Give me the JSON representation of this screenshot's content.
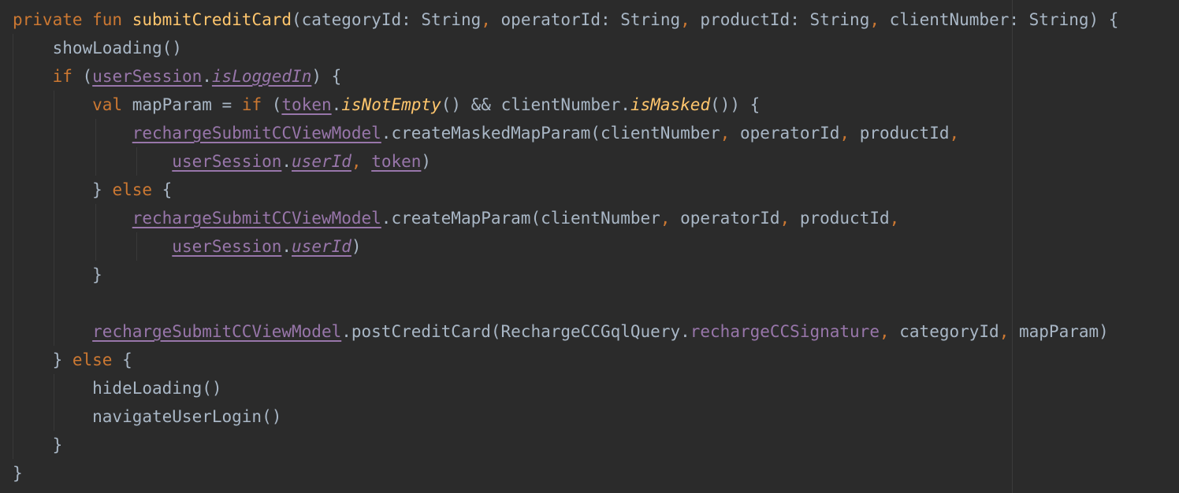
{
  "editor": {
    "language": "kotlin",
    "theme_colors": {
      "background": "#2b2b2b",
      "plain": "#a9b7c6",
      "keyword": "#cc7832",
      "function": "#ffc66d",
      "property": "#9876aa"
    },
    "lines": [
      [
        {
          "t": "private fun ",
          "k": "keyword"
        },
        {
          "t": "submitCreditCard",
          "k": "function"
        },
        {
          "t": "(categoryId: String",
          "k": "plain"
        },
        {
          "t": ", ",
          "k": "comma"
        },
        {
          "t": "operatorId: String",
          "k": "plain"
        },
        {
          "t": ", ",
          "k": "comma"
        },
        {
          "t": "productId: String",
          "k": "plain"
        },
        {
          "t": ", ",
          "k": "comma"
        },
        {
          "t": "clientNumber: String) {",
          "k": "plain"
        }
      ],
      [
        {
          "t": "    showLoading()",
          "k": "plain"
        }
      ],
      [
        {
          "t": "    ",
          "k": "plain"
        },
        {
          "t": "if ",
          "k": "keyword"
        },
        {
          "t": "(",
          "k": "plain"
        },
        {
          "t": "userSession",
          "k": "prop"
        },
        {
          "t": ".",
          "k": "plain"
        },
        {
          "t": "isLoggedIn",
          "k": "prop-italic"
        },
        {
          "t": ") {",
          "k": "plain"
        }
      ],
      [
        {
          "t": "        ",
          "k": "plain"
        },
        {
          "t": "val ",
          "k": "keyword"
        },
        {
          "t": "mapParam = ",
          "k": "plain"
        },
        {
          "t": "if ",
          "k": "keyword"
        },
        {
          "t": "(",
          "k": "plain"
        },
        {
          "t": "token",
          "k": "prop"
        },
        {
          "t": ".",
          "k": "plain"
        },
        {
          "t": "isNotEmpty",
          "k": "ext"
        },
        {
          "t": "() && clientNumber.",
          "k": "plain"
        },
        {
          "t": "isMasked",
          "k": "ext"
        },
        {
          "t": "()) {",
          "k": "plain"
        }
      ],
      [
        {
          "t": "            ",
          "k": "plain"
        },
        {
          "t": "rechargeSubmitCCViewModel",
          "k": "prop"
        },
        {
          "t": ".createMaskedMapParam(clientNumber",
          "k": "plain"
        },
        {
          "t": ", ",
          "k": "comma"
        },
        {
          "t": "operatorId",
          "k": "plain"
        },
        {
          "t": ", ",
          "k": "comma"
        },
        {
          "t": "productId",
          "k": "plain"
        },
        {
          "t": ",",
          "k": "comma"
        }
      ],
      [
        {
          "t": "                ",
          "k": "plain"
        },
        {
          "t": "userSession",
          "k": "prop"
        },
        {
          "t": ".",
          "k": "plain"
        },
        {
          "t": "userId",
          "k": "prop-italic"
        },
        {
          "t": ", ",
          "k": "comma"
        },
        {
          "t": "token",
          "k": "prop"
        },
        {
          "t": ")",
          "k": "plain"
        }
      ],
      [
        {
          "t": "        } ",
          "k": "plain"
        },
        {
          "t": "else ",
          "k": "keyword"
        },
        {
          "t": "{",
          "k": "plain"
        }
      ],
      [
        {
          "t": "            ",
          "k": "plain"
        },
        {
          "t": "rechargeSubmitCCViewModel",
          "k": "prop"
        },
        {
          "t": ".createMapParam(clientNumber",
          "k": "plain"
        },
        {
          "t": ", ",
          "k": "comma"
        },
        {
          "t": "operatorId",
          "k": "plain"
        },
        {
          "t": ", ",
          "k": "comma"
        },
        {
          "t": "productId",
          "k": "plain"
        },
        {
          "t": ",",
          "k": "comma"
        }
      ],
      [
        {
          "t": "                ",
          "k": "plain"
        },
        {
          "t": "userSession",
          "k": "prop"
        },
        {
          "t": ".",
          "k": "plain"
        },
        {
          "t": "userId",
          "k": "prop-italic"
        },
        {
          "t": ")",
          "k": "plain"
        }
      ],
      [
        {
          "t": "        }",
          "k": "plain"
        }
      ],
      [
        {
          "t": "",
          "k": "plain"
        }
      ],
      [
        {
          "t": "        ",
          "k": "plain"
        },
        {
          "t": "rechargeSubmitCCViewModel",
          "k": "prop"
        },
        {
          "t": ".postCreditCard(RechargeCCGqlQuery.",
          "k": "plain"
        },
        {
          "t": "rechargeCCSignature",
          "k": "prop-static"
        },
        {
          "t": ", ",
          "k": "comma"
        },
        {
          "t": "categoryId",
          "k": "plain"
        },
        {
          "t": ", ",
          "k": "comma"
        },
        {
          "t": "mapParam)",
          "k": "plain"
        }
      ],
      [
        {
          "t": "    } ",
          "k": "plain"
        },
        {
          "t": "else ",
          "k": "keyword"
        },
        {
          "t": "{",
          "k": "plain"
        }
      ],
      [
        {
          "t": "        hideLoading()",
          "k": "plain"
        }
      ],
      [
        {
          "t": "        navigateUserLogin()",
          "k": "plain"
        }
      ],
      [
        {
          "t": "    }",
          "k": "plain"
        }
      ],
      [
        {
          "t": "}",
          "k": "plain"
        }
      ]
    ]
  }
}
